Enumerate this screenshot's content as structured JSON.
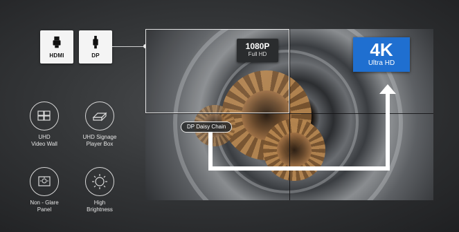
{
  "ports": [
    {
      "label": "HDMI",
      "icon": "hdmi-connector-icon"
    },
    {
      "label": "DP",
      "icon": "displayport-connector-icon"
    }
  ],
  "features": [
    {
      "label_line1": "UHD",
      "label_line2": "Video Wall",
      "icon": "video-wall-icon"
    },
    {
      "label_line1": "UHD Signage",
      "label_line2": "Player Box",
      "icon": "player-box-icon"
    },
    {
      "label_line1": "Non - Glare",
      "label_line2": "Panel",
      "icon": "non-glare-icon"
    },
    {
      "label_line1": "High",
      "label_line2": "Brightness",
      "icon": "brightness-icon"
    }
  ],
  "badges": {
    "fhd_main": "1080P",
    "fhd_sub": "Full HD",
    "uhd_main": "4K",
    "uhd_sub": "Ultra HD"
  },
  "daisy_chain_label": "DP Daisy Chain",
  "colors": {
    "uhd_badge": "#1f6fd0",
    "background": "#343638"
  }
}
